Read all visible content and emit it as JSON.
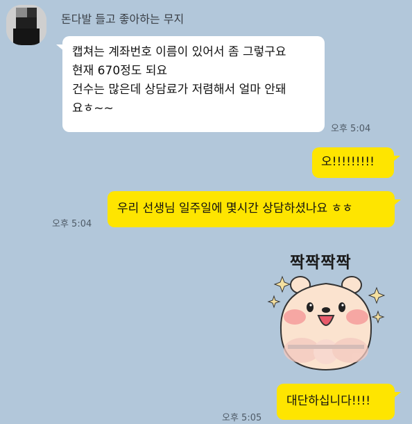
{
  "chat": {
    "sender_name": "돈다발 들고 좋아하는 무지",
    "messages": [
      {
        "side": "in",
        "lines": [
          "캡쳐는 계좌번호 이름이 있어서 좀 그렇구요",
          "현재 670정도 되요",
          "건수는 많은데 상담료가 저렴해서 얼마 안돼",
          "요ㅎ~~"
        ],
        "time": "오후 5:04"
      },
      {
        "side": "out",
        "lines": [
          "오!!!!!!!!!"
        ]
      },
      {
        "side": "out",
        "lines": [
          "우리 선생님 일주일에 몇시간 상담하셨나요 ㅎㅎ"
        ],
        "time": "오후 5:04"
      },
      {
        "side": "out",
        "sticker": "cheek-squish-bear-sticker",
        "sticker_text": "짝짝짝짝"
      },
      {
        "side": "out",
        "lines": [
          "대단하십니다!!!!"
        ],
        "time": "오후 5:05"
      }
    ]
  },
  "colors": {
    "background": "#b2c7da",
    "bubble_in": "#ffffff",
    "bubble_out": "#fee500",
    "time_text": "#4e5a66"
  }
}
